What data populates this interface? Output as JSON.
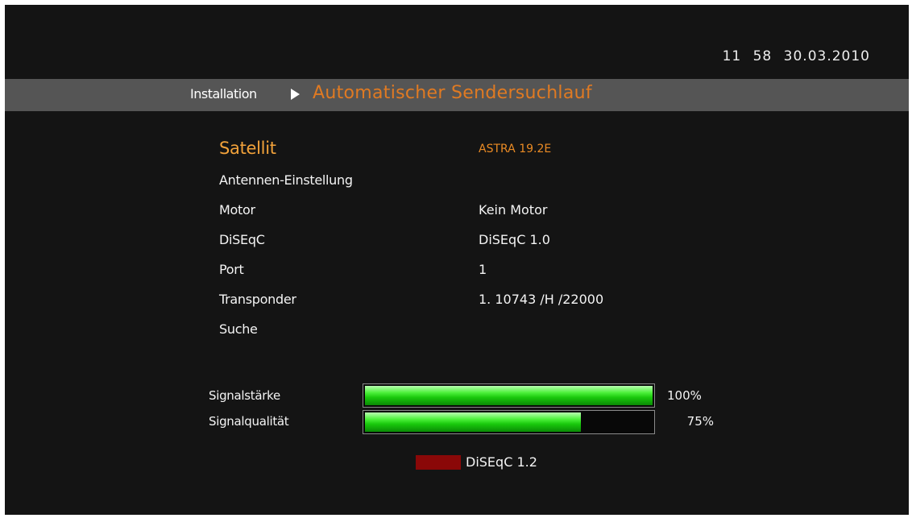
{
  "clock": {
    "time": "11 58",
    "date": "30.03.2010"
  },
  "header": {
    "root": "Installation",
    "separator_icon": "play-arrow-icon",
    "current": "Automatischer Sendersuchlauf"
  },
  "menu": {
    "items": [
      {
        "label": "Satellit",
        "value": "ASTRA 19.2E",
        "selected": true
      },
      {
        "label": "Antennen-Einstellung",
        "value": ""
      },
      {
        "label": "Motor",
        "value": "Kein Motor"
      },
      {
        "label": "DiSEqC",
        "value": "DiSEqC 1.0"
      },
      {
        "label": "Port",
        "value": "1"
      },
      {
        "label": "Transponder",
        "value": "1. 10743 /H /22000"
      },
      {
        "label": "Suche",
        "value": ""
      }
    ]
  },
  "signal": {
    "strength": {
      "label": "Signalstärke",
      "percent_text": "100%",
      "value": 1.0
    },
    "quality": {
      "label": "Signalqualität",
      "percent_text": "75%",
      "value": 0.75
    }
  },
  "footer": {
    "red_key_label": "DiSEqC 1.2",
    "red_key_color": "#8a0808"
  },
  "colors": {
    "accent": "#e07a22",
    "selected_label": "#f2a23a",
    "bar_fill": "#19c80c"
  }
}
